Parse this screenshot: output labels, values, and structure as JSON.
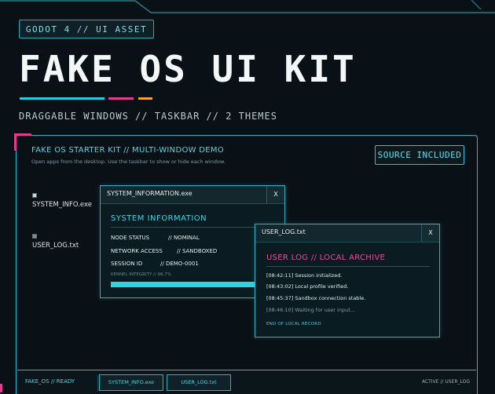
{
  "header": {
    "badge": "GODOT 4 // UI ASSET",
    "title": "FAKE OS UI KIT",
    "subtitle": "DRAGGABLE WINDOWS // TASKBAR // 2 THEMES"
  },
  "colors": {
    "accent_cyan": "#25cfe0",
    "accent_magenta": "#e23b90",
    "accent_orange": "#f0a526",
    "background": "#0a1116"
  },
  "desktop": {
    "title": "FAKE OS STARTER KIT // MULTI-WINDOW DEMO",
    "hint": "Open apps from the desktop. Use the taskbar to show or hide each window.",
    "source_button": "SOURCE INCLUDED",
    "icons": [
      {
        "label": "SYSTEM_INFO.exe",
        "icon": "window-icon"
      },
      {
        "label": "USER_LOG.txt",
        "icon": "document-icon"
      }
    ]
  },
  "system_window": {
    "title": "SYSTEM_INFORMATION.exe",
    "close": "X",
    "heading": "SYSTEM INFORMATION",
    "rows": [
      {
        "key": "NODE STATUS",
        "value": "// NOMINAL"
      },
      {
        "key": "NETWORK ACCESS",
        "value": "// SANDBOXED"
      },
      {
        "key": "SESSION ID",
        "value": "// DEMO-0001"
      }
    ],
    "integrity_label": "KERNEL INTEGRITY // 98.7%",
    "integrity_percent": 98.7
  },
  "log_window": {
    "title": "USER_LOG.txt",
    "close": "X",
    "heading": "USER LOG // LOCAL ARCHIVE",
    "lines": [
      "[08:42:11] Session initialized.",
      "[08:43:02] Local profile verified.",
      "[08:45:37] Sandbox connection stable.",
      "[08:46:10] Waiting for user input..."
    ],
    "end": "END OF LOCAL RECORD"
  },
  "taskbar": {
    "status": "FAKE_OS // READY",
    "buttons": [
      "SYSTEM_INFO.exe",
      "USER_LOG.txt"
    ],
    "active": "ACTIVE // USER_LOG"
  }
}
